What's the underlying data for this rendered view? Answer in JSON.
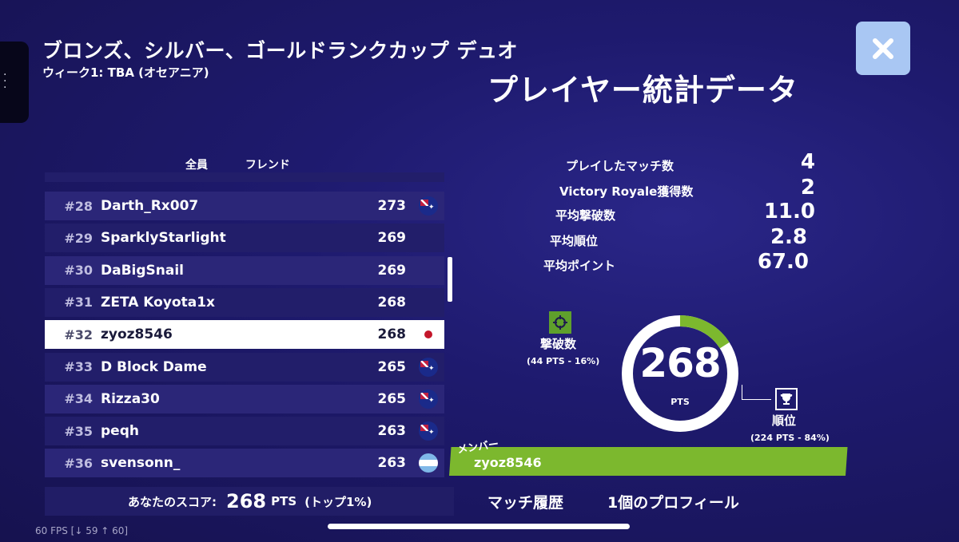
{
  "header": {
    "cup_title": "ブロンズ、シルバー、ゴールドランクカップ デュオ",
    "week": "ウィーク1: TBA (オセアニア)",
    "page_title": "プレイヤー統計データ"
  },
  "tabs": [
    "全員",
    "フレンド"
  ],
  "leaderboard": [
    {
      "rank": "#28",
      "name": "Darth_Rx007",
      "points": "273",
      "flag": "au"
    },
    {
      "rank": "#29",
      "name": "SparklyStarlight",
      "points": "269",
      "flag": ""
    },
    {
      "rank": "#30",
      "name": "DaBigSnail",
      "points": "269",
      "flag": ""
    },
    {
      "rank": "#31",
      "name": "ZETA Koyota1x",
      "points": "268",
      "flag": ""
    },
    {
      "rank": "#32",
      "name": "zyoz8546",
      "points": "268",
      "flag": "jp"
    },
    {
      "rank": "#33",
      "name": "D Block Dame",
      "points": "265",
      "flag": "au"
    },
    {
      "rank": "#34",
      "name": "Rizza30",
      "points": "265",
      "flag": "au"
    },
    {
      "rank": "#35",
      "name": "peqh",
      "points": "263",
      "flag": "au"
    },
    {
      "rank": "#36",
      "name": "svensonn_",
      "points": "263",
      "flag": "ar"
    }
  ],
  "score_bar": {
    "label": "あなたのスコア:",
    "value": "268",
    "unit": "PTS",
    "top": "(トップ1%)"
  },
  "buttons": {
    "match_history": "マッチ履歴",
    "profile": "1個のプロフィール"
  },
  "stats": [
    {
      "label": "プレイしたマッチ数",
      "value": "4"
    },
    {
      "label": "Victory Royale獲得数",
      "value": "2"
    },
    {
      "label": "平均撃破数",
      "value": "11.0"
    },
    {
      "label": "平均順位",
      "value": "2.8"
    },
    {
      "label": "平均ポイント",
      "value": "67.0"
    }
  ],
  "breakdown": {
    "total": "268",
    "unit": "PTS",
    "eliminations_label": "撃破数",
    "eliminations_sub": "(44 PTS - 16%)",
    "eliminations_fraction": 0.16,
    "placement_label": "順位",
    "placement_sub": "(224 PTS - 84%)"
  },
  "member": {
    "label": "メンバー",
    "name": "zyoz8546"
  },
  "fps": "60 FPS [↓ 59 ↑ 60]",
  "colors": {
    "accent_green": "#7cb82e",
    "close_button": "#a9c7f3",
    "background": "#1e1a6e"
  }
}
